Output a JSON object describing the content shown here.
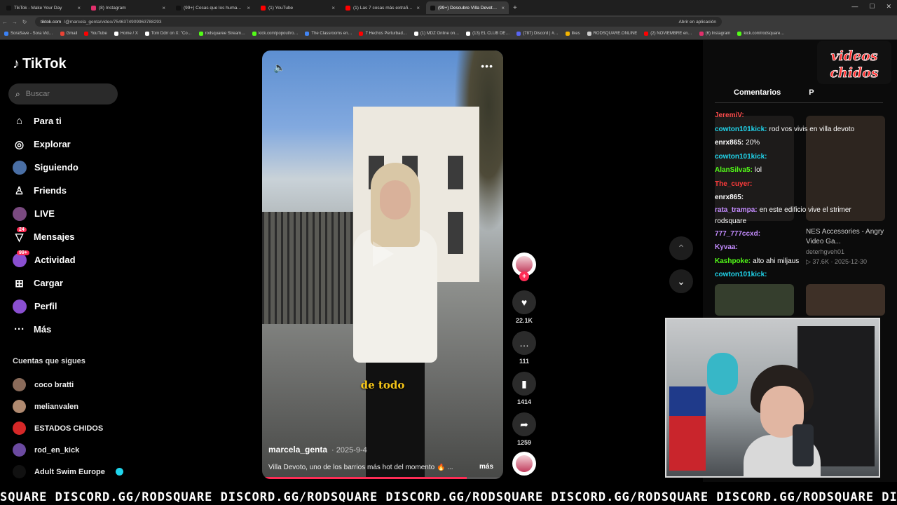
{
  "browser": {
    "tabs": [
      {
        "label": "TikTok - Make Your Day",
        "color": "#111111"
      },
      {
        "label": "(8) Instagram",
        "color": "#e1306c"
      },
      {
        "label": "(99+) Cosas que los humanos n…",
        "color": "#111111"
      },
      {
        "label": "(1) YouTube",
        "color": "#ff0000"
      },
      {
        "label": "(1) Las 7 cosas más extrañas q…",
        "color": "#ff0000"
      },
      {
        "label": "(99+) Descubre Villa Devot…",
        "color": "#111111",
        "active": true
      }
    ],
    "url_domain": "tiktok.com",
    "url_path": "/@marcela_genta/video/7546374909963788293",
    "open_in_app": "Abrir en aplicación",
    "bookmarks": [
      {
        "label": "SoraSave - Sora Vid…",
        "color": "#3b82f6"
      },
      {
        "label": "Gmail",
        "color": "#ea4335"
      },
      {
        "label": "YouTube",
        "color": "#ff0000"
      },
      {
        "label": "Home / X",
        "color": "#ffffff"
      },
      {
        "label": "Tom Ddrr on X: \"Co…",
        "color": "#ffffff"
      },
      {
        "label": "rodsquaree Stream…",
        "color": "#53fc18"
      },
      {
        "label": "kick.com/popout/ro…",
        "color": "#53fc18"
      },
      {
        "label": "The Classrooms en…",
        "color": "#4285f4"
      },
      {
        "label": "7 Hechos Perturbad…",
        "color": "#ff0000"
      },
      {
        "label": "(1) MDZ Online on…",
        "color": "#ffffff"
      },
      {
        "label": "(13) EL CLUB DE…",
        "color": "#ffffff"
      },
      {
        "label": "(787) Discord | #…",
        "color": "#5865f2"
      },
      {
        "label": "likes",
        "color": "#f4b400"
      },
      {
        "label": "RODSQUARE.ONLINE",
        "color": "#cccccc"
      },
      {
        "label": "(2) NOVIEMBRE en…",
        "color": "#ff0000"
      },
      {
        "label": "(6) Instagram",
        "color": "#e1306c"
      },
      {
        "label": "kick.com/rodsquare…",
        "color": "#53fc18"
      }
    ]
  },
  "sidebar": {
    "logo": "TikTok",
    "search_placeholder": "Buscar",
    "nav": [
      {
        "label": "Para ti",
        "icon": "home-icon",
        "glyph": "⌂"
      },
      {
        "label": "Explorar",
        "icon": "compass-icon",
        "glyph": "◎"
      },
      {
        "label": "Siguiendo",
        "icon": "following-avatar-icon",
        "glyph": "●"
      },
      {
        "label": "Friends",
        "icon": "friends-icon",
        "glyph": "♙"
      },
      {
        "label": "LIVE",
        "icon": "live-avatar-icon",
        "glyph": "●"
      },
      {
        "label": "Mensajes",
        "icon": "messages-icon",
        "glyph": "▽",
        "badge": "24"
      },
      {
        "label": "Actividad",
        "icon": "activity-icon",
        "glyph": "●",
        "badge": "99+"
      },
      {
        "label": "Cargar",
        "icon": "upload-icon",
        "glyph": "⊞"
      },
      {
        "label": "Perfil",
        "icon": "profile-avatar-icon",
        "glyph": "●"
      },
      {
        "label": "Más",
        "icon": "more-icon",
        "glyph": "···"
      }
    ],
    "following_title": "Cuentas que sigues",
    "following": [
      {
        "name": "coco bratti",
        "color": "#8a6b5a"
      },
      {
        "name": "melianvalen",
        "color": "#b08a70"
      },
      {
        "name": "ESTADOS CHIDOS",
        "color": "#d62828"
      },
      {
        "name": "rod_en_kick",
        "color": "#6b4aa0"
      },
      {
        "name": "Adult Swim Europe",
        "color": "#111111",
        "verified": true
      }
    ]
  },
  "video": {
    "caption_overlay": "de todo",
    "author": "marcela_genta",
    "date": "· 2025-9-4",
    "description": "Villa Devoto, uno de los barrios más hot del momento 🔥 ...",
    "more_label": "más",
    "progress": 0.85
  },
  "actions": {
    "likes": "22.1K",
    "comments": "111",
    "saves": "1414",
    "shares": "1259"
  },
  "right_panel": {
    "tab_comments": "Comentarios",
    "tab_other": "P",
    "related": {
      "title": "NES Accessories - Angry Video Ga...",
      "channel": "deterhgveh01",
      "meta": "▷ 37.6K · 2025-12-30"
    }
  },
  "stream_chat": [
    {
      "user": "JeremiV:",
      "color": "#ff4d4d",
      "msg": ""
    },
    {
      "user": "cowton101kick:",
      "color": "#20d5ec",
      "msg": "rod vos vivis en villa devoto"
    },
    {
      "user": "enrx865:",
      "color": "#ffffff",
      "msg": "20%"
    },
    {
      "user": "cowton101kick:",
      "color": "#20d5ec",
      "msg": ""
    },
    {
      "user": "AlanSilva5:",
      "color": "#53fc18",
      "msg": "lol"
    },
    {
      "user": "The_cuyer:",
      "color": "#ff3b3b",
      "msg": ""
    },
    {
      "user": "enrx865:",
      "color": "#ffffff",
      "msg": ""
    },
    {
      "user": "rata_trampa:",
      "color": "#c48cff",
      "msg": "en este edificio vive el strimer rodsquare"
    },
    {
      "user": "777_777ccxd:",
      "color": "#c48cff",
      "msg": ""
    },
    {
      "user": "Kyvaa:",
      "color": "#c48cff",
      "msg": ""
    },
    {
      "user": "Kashpoke:",
      "color": "#53fc18",
      "msg": "alto ahi miljaus"
    },
    {
      "user": "cowton101kick:",
      "color": "#20d5ec",
      "msg": ""
    }
  ],
  "overlay_logo": "videos chidos",
  "ticker": "SQUARE DISCORD.GG/RODSQUARE DISCORD.GG/RODSQUARE DISCORD.GG/RODSQUARE DISCORD.GG/RODSQUARE DISCORD.GG/RODSQUARE DISCORD.GG/RO"
}
